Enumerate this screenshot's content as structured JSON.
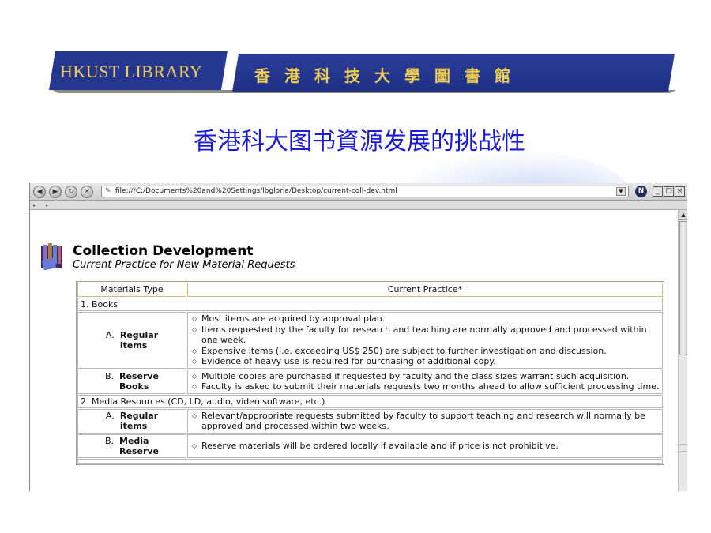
{
  "slide": {
    "banner_en": "HKUST LIBRARY",
    "banner_zh": "香港科技大學圖書館",
    "title": "香港科大图书資源发展的挑战性"
  },
  "browser": {
    "url": "file:///C:/Documents%20and%20Settings/lbgloria/Desktop/current-coll-dev.html",
    "nav_icons": [
      "back-icon",
      "forward-icon",
      "reload-icon",
      "stop-icon"
    ],
    "window_icons": [
      "minimize-icon",
      "maximize-icon",
      "close-icon"
    ]
  },
  "page": {
    "heading": "Collection Development",
    "subheading": "Current Practice for New Material Requests",
    "table": {
      "headers": [
        "Materials Type",
        "Current Practice*"
      ],
      "sections": [
        {
          "title": "1. Books",
          "items": [
            {
              "letter": "A.",
              "label_line1": "Regular",
              "label_line2": "items",
              "bullets": [
                "Most items are acquired by approval plan.",
                "Items requested by the faculty for research and teaching are normally approved and processed within one week.",
                "Expensive items (i.e. exceeding US$ 250) are subject to further investigation and discussion.",
                "Evidence of heavy use is required for purchasing of additional copy."
              ]
            },
            {
              "letter": "B.",
              "label_line1": "Reserve",
              "label_line2": "Books",
              "bullets": [
                "Multiple copies are purchased if requested by faculty and the class sizes warrant such acquisition.",
                "Faculty is asked to submit their materials requests two months ahead to allow sufficient processing time."
              ]
            }
          ]
        },
        {
          "title": "2. Media Resources (CD, LD, audio, video software, etc.)",
          "items": [
            {
              "letter": "A.",
              "label_line1": "Regular",
              "label_line2": "items",
              "bullets": [
                "Relevant/appropriate requests submitted by faculty to support teaching and research will normally be approved and processed within two weeks."
              ]
            },
            {
              "letter": "B.",
              "label_line1": "Media",
              "label_line2": "Reserve",
              "bullets": [
                "Reserve materials will be ordered locally if available and if price is not prohibitive."
              ]
            }
          ]
        }
      ]
    }
  },
  "colors": {
    "banner_blue": "#26378f",
    "banner_text": "#f0d050",
    "title_blue": "#1b1bd6",
    "header_border": "#d2b980"
  }
}
